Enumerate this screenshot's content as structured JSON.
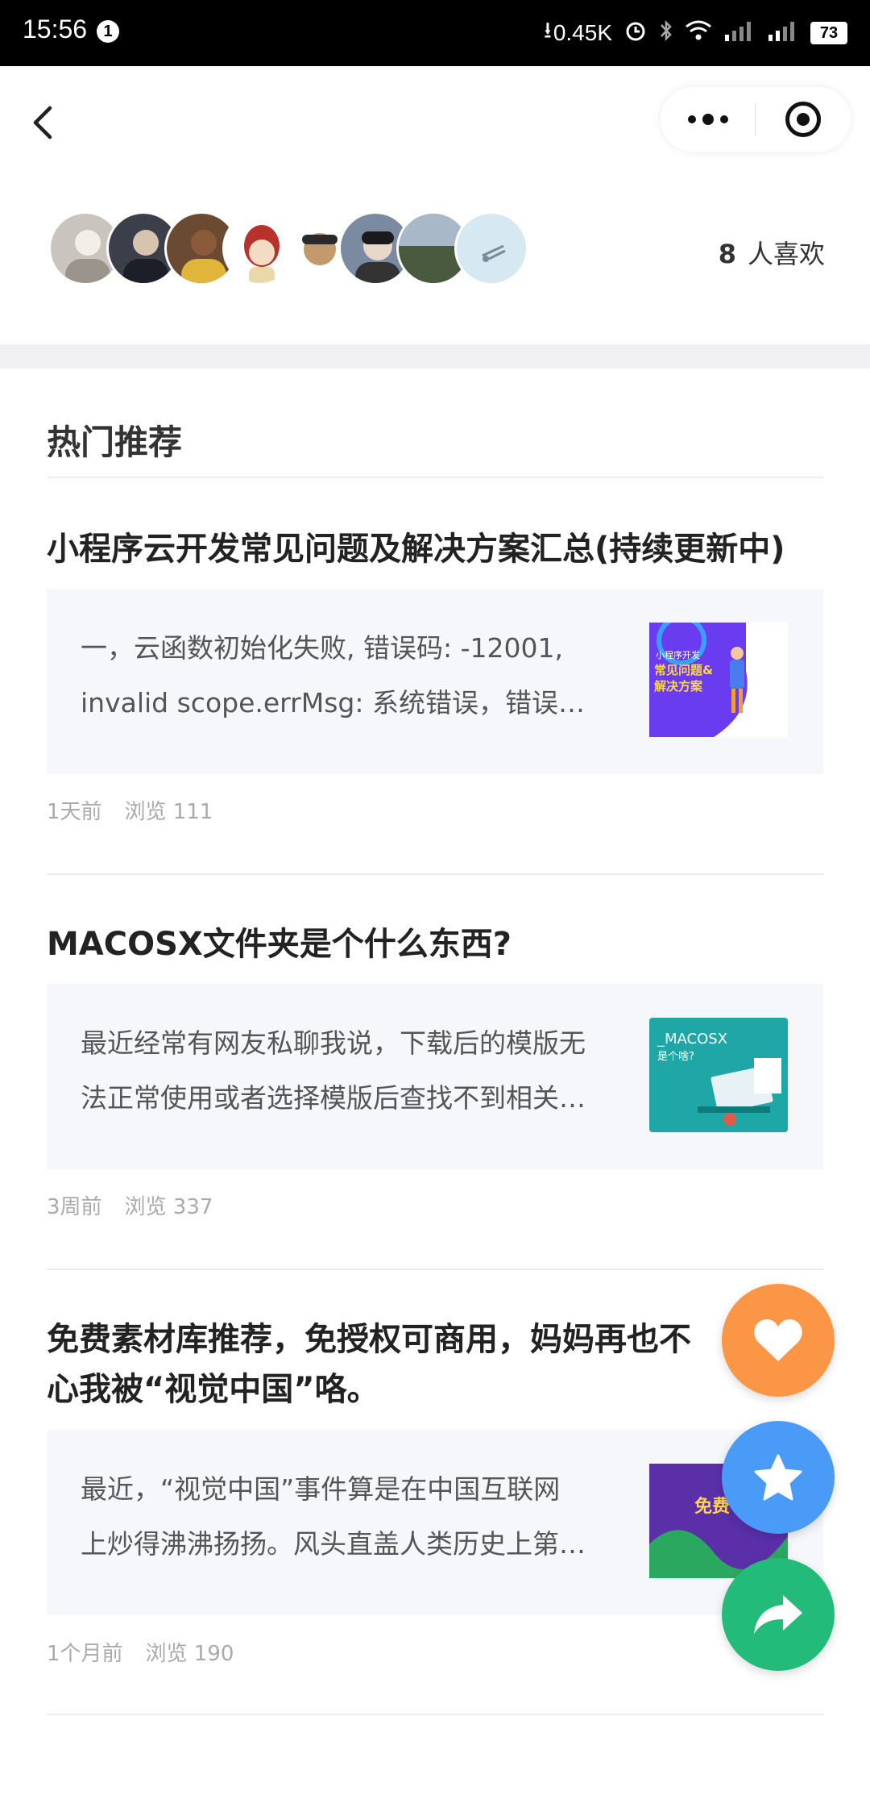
{
  "status_bar": {
    "time": "15:56",
    "notification_count": "1",
    "net_speed": "0.45K",
    "battery": "73"
  },
  "likes": {
    "count": "8",
    "label": "人喜欢",
    "avatars": [
      {
        "color": "#c9c4be"
      },
      {
        "color": "#3b3f4a"
      },
      {
        "color": "#6b4a32"
      },
      {
        "color": "#e9dcc8"
      },
      {
        "color": "#b88a60"
      },
      {
        "color": "#7a8aa0"
      },
      {
        "color": "#5a6a50"
      },
      {
        "color": "#d6e8f2"
      }
    ]
  },
  "section": {
    "title": "热门推荐"
  },
  "articles": [
    {
      "title": "小程序云开发常见问题及解决方案汇总(持续更新中)",
      "excerpt_line1": "一，云函数初始化失败, 错误码: -12001,",
      "excerpt_line2": "invalid scope.errMsg: 系统错误，错误…",
      "time": "1天前",
      "views": "浏览 111",
      "thumb_text": "常见问题&解决方案",
      "thumb_sub": "小程序开发",
      "thumb_color": "#6a3cf0"
    },
    {
      "title": "MACOSX文件夹是个什么东西?",
      "excerpt_line1": "最近经常有网友私聊我说，下载后的模版无",
      "excerpt_line2": "法正常使用或者选择模版后查找不到相关…",
      "time": "3周前",
      "views": "浏览 337",
      "thumb_text": "_MACOSX",
      "thumb_sub": "是个啥?",
      "thumb_color": "#1fa7a8"
    },
    {
      "title_line1": "免费素材库推荐，免授权可商用，妈妈再也不",
      "title_line2": "心我被“视觉中国”咯。",
      "excerpt_line1": "最近，“视觉中国”事件算是在中国互联网",
      "excerpt_line2": "上炒得沸沸扬扬。风头直盖人类历史上第…",
      "time": "1个月前",
      "views": "浏览 190",
      "thumb_text": "免费",
      "thumb_color": "#5a2fa8"
    }
  ],
  "colors": {
    "like_fab": "#fb9646",
    "favorite_fab": "#4a9bf7",
    "share_fab": "#23bb7a"
  }
}
